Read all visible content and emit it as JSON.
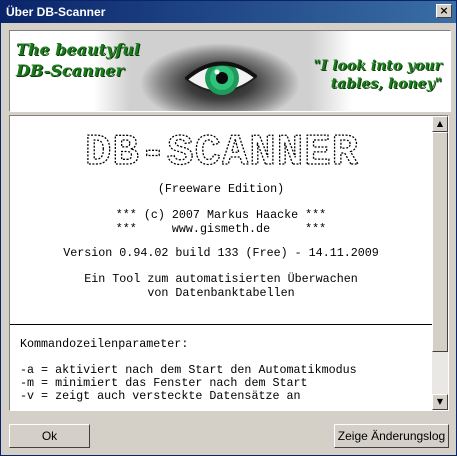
{
  "window": {
    "title": "Über DB-Scanner",
    "close_symbol": "×"
  },
  "banner": {
    "title": "The beautyful\nDB-Scanner",
    "quote": "\"I look into your\ntables, honey\""
  },
  "about": {
    "logo_text": "DB-SCANNER",
    "edition": "(Freeware Edition)",
    "copyright_line1": "*** (c) 2007 Markus Haacke ***",
    "copyright_line2": "***     www.gismeth.de     ***",
    "version": "Version 0.94.02 build 133 (Free) - 14.11.2009",
    "description_line1": "Ein Tool zum automatisierten Überwachen",
    "description_line2": "von Datenbanktabellen",
    "params_header": "Kommandozeilenparameter:",
    "params": [
      "-a = aktiviert nach dem Start den Automatikmodus",
      "-m = minimiert das Fenster nach dem Start",
      "-v = zeigt auch versteckte Datensätze an"
    ]
  },
  "buttons": {
    "ok": "Ok",
    "changelog": "Zeige Änderungslog"
  }
}
